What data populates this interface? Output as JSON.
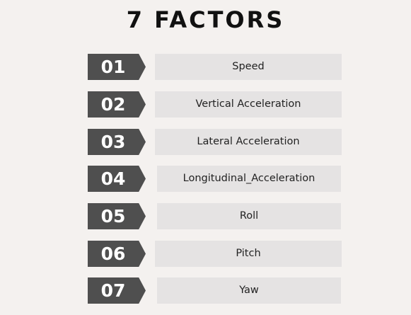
{
  "title": "7 FACTORS",
  "factors": [
    {
      "number": "01",
      "label": "Speed"
    },
    {
      "number": "02",
      "label": "Vertical Acceleration"
    },
    {
      "number": "03",
      "label": "Lateral Acceleration"
    },
    {
      "number": "04",
      "label": "Longitudinal_Acceleration"
    },
    {
      "number": "05",
      "label": "Roll"
    },
    {
      "number": "06",
      "label": "Pitch"
    },
    {
      "number": "07",
      "label": "Yaw"
    }
  ],
  "colors": {
    "background": "#f4f1ef",
    "number_tag": "#4f4f4f",
    "label_box": "#e5e3e3",
    "title_text": "#111111"
  }
}
